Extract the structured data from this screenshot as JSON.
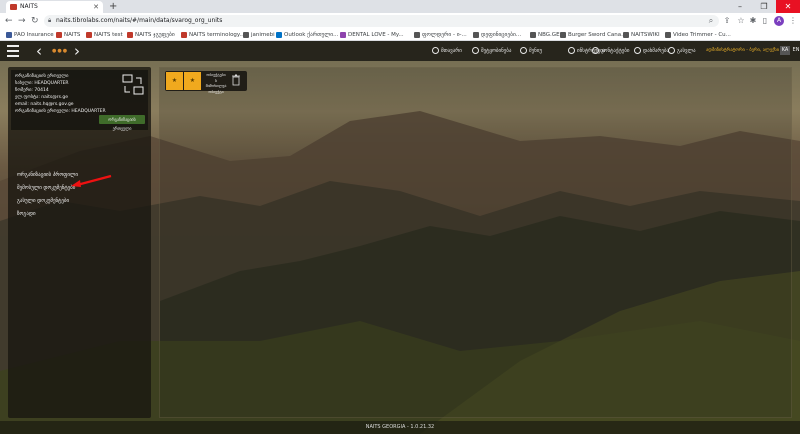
{
  "browser": {
    "tab_title": "NAITS",
    "url": "naits.tibrolabs.com/naits/#/main/data/svarog_org_units",
    "avatar_letter": "A",
    "bookmarks": [
      {
        "label": "PAO Insurance",
        "color": "#3b5998"
      },
      {
        "label": "NAITS",
        "color": "#c0392b"
      },
      {
        "label": "NAITS test",
        "color": "#c0392b"
      },
      {
        "label": "NAITS ჯგუფები",
        "color": "#c0392b"
      },
      {
        "label": "NAITS terminology...",
        "color": "#c0392b"
      },
      {
        "label": "janimebi",
        "color": "#555"
      },
      {
        "label": "Outlook ქართული...",
        "color": "#0072c6"
      },
      {
        "label": "DENTAL LOVE - My...",
        "color": "#8e44ad"
      },
      {
        "label": "ფოლდერი - ი-...",
        "color": "#555"
      },
      {
        "label": "დეფინიციები...",
        "color": "#555"
      },
      {
        "label": "NBG.GE",
        "color": "#555"
      },
      {
        "label": "Burger Sword Cana...",
        "color": "#555"
      },
      {
        "label": "NAITSWIKI",
        "color": "#555"
      },
      {
        "label": "Video Trimmer - Cu...",
        "color": "#555"
      }
    ]
  },
  "topnav": {
    "menu": [
      "მთავარი",
      "შეტყობინება",
      "მენიუ",
      "ინსტრუქცია",
      "კონტაქტები",
      "დახმარება",
      "გასვლა"
    ],
    "user_link": "ადმინისტრატორი - ბერი, ალექსი",
    "languages": [
      "KA",
      "EN"
    ]
  },
  "leftpanel": {
    "info_lines": [
      "ორგანიზაციის ერთეული",
      "სახელი: HEADQUARTER",
      "ნომერი: 70414",
      "ელ.ფოსტა: naits@rs.ge",
      "email: naits.hq@rs.gov.ge",
      "ორგანიზაციის ერთეული: HEADQUARTER"
    ],
    "org_button": "ორგანიზაციის ერთეული",
    "nav": [
      "ორგანიზაციის პროფილი",
      "შემოსული დოკუმენტები",
      "გასული დოკუმენტები",
      "ზოგადი"
    ]
  },
  "widget": {
    "text_lines": [
      "ობიექტები",
      "ს",
      "მიმოხილვა",
      "ობიექტი"
    ]
  },
  "footer": {
    "version": "NAITS GEORGIA - 1.0.21.32"
  }
}
